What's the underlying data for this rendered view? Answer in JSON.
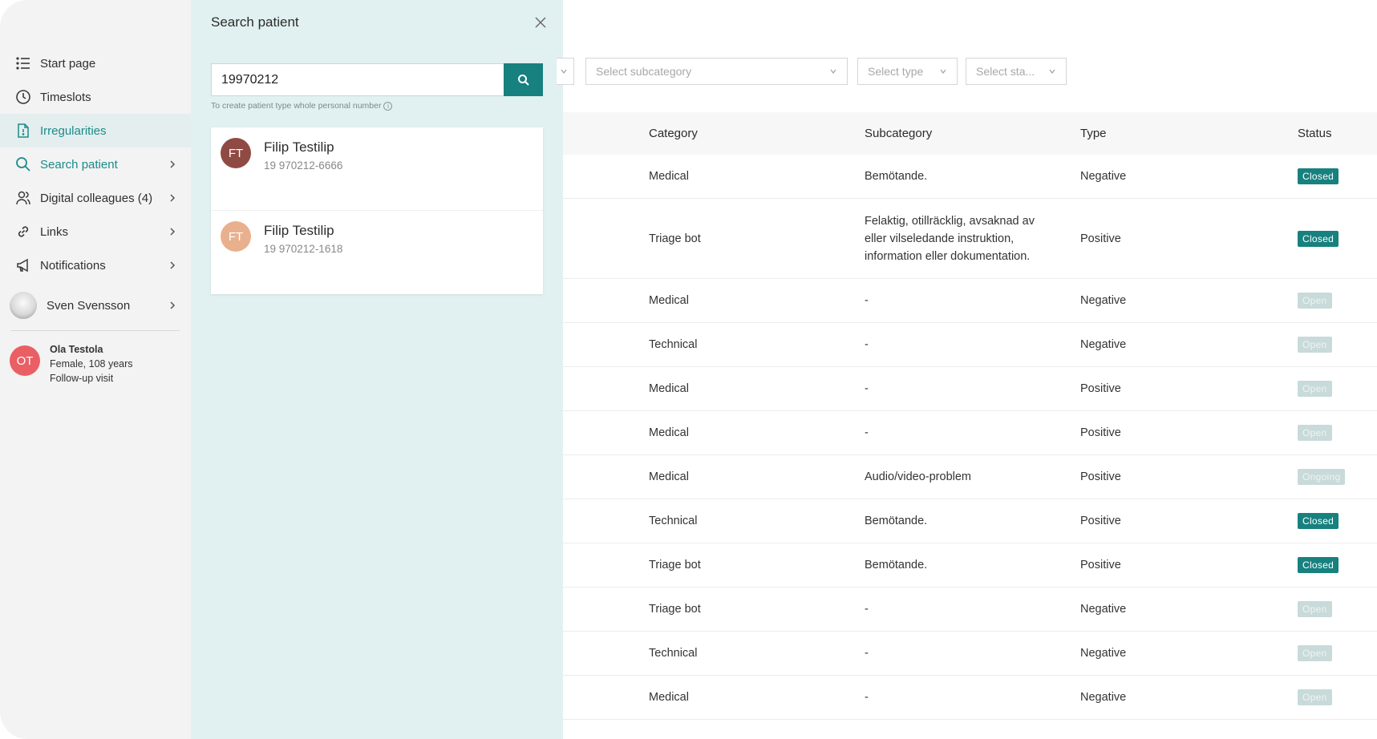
{
  "sidebar": {
    "items": [
      {
        "label": "Start page",
        "icon": "list-icon"
      },
      {
        "label": "Timeslots",
        "icon": "clock-icon"
      },
      {
        "label": "Irregularities",
        "icon": "document-icon"
      },
      {
        "label": "Search patient",
        "icon": "search-icon"
      },
      {
        "label": "Digital colleagues (4)",
        "icon": "people-icon"
      },
      {
        "label": "Links",
        "icon": "link-icon"
      },
      {
        "label": "Notifications",
        "icon": "megaphone-icon"
      }
    ],
    "user": {
      "name": "Sven Svensson"
    },
    "current_patient": {
      "initials": "OT",
      "name": "Ola Testola",
      "details": "Female, 108 years",
      "visit": "Follow-up visit"
    }
  },
  "search_panel": {
    "title": "Search patient",
    "query": "19970212",
    "hint": "To create patient type whole personal number",
    "results": [
      {
        "initials": "FT",
        "name": "Filip Testilip",
        "pnr": "19 970212-6666",
        "color": "#8f4a43"
      },
      {
        "initials": "FT",
        "name": "Filip Testilip",
        "pnr": "19 970212-1618",
        "color": "#e9b08e"
      }
    ]
  },
  "filters": {
    "subcategory": "Select subcategory",
    "type": "Select type",
    "status": "Select sta..."
  },
  "table": {
    "headers": {
      "category": "Category",
      "subcategory": "Subcategory",
      "type": "Type",
      "status": "Status"
    },
    "rows": [
      {
        "category": "Medical",
        "subcategory": "Bemötande.",
        "type": "Negative",
        "status": "Closed"
      },
      {
        "category": "Triage bot",
        "subcategory": "Felaktig, otillräcklig, avsaknad av eller vilseledande instruktion, information eller dokumentation.",
        "type": "Positive",
        "status": "Closed"
      },
      {
        "category": "Medical",
        "subcategory": "-",
        "type": "Negative",
        "status": "Open"
      },
      {
        "category": "Technical",
        "subcategory": "-",
        "type": "Negative",
        "status": "Open"
      },
      {
        "category": "Medical",
        "subcategory": "-",
        "type": "Positive",
        "status": "Open"
      },
      {
        "category": "Medical",
        "subcategory": "-",
        "type": "Positive",
        "status": "Open"
      },
      {
        "category": "Medical",
        "subcategory": "Audio/video-problem",
        "type": "Positive",
        "status": "Ongoing"
      },
      {
        "category": "Technical",
        "subcategory": "Bemötande.",
        "type": "Positive",
        "status": "Closed"
      },
      {
        "category": "Triage bot",
        "subcategory": "Bemötande.",
        "type": "Positive",
        "status": "Closed"
      },
      {
        "category": "Triage bot",
        "subcategory": "-",
        "type": "Negative",
        "status": "Open"
      },
      {
        "category": "Technical",
        "subcategory": "-",
        "type": "Negative",
        "status": "Open"
      },
      {
        "category": "Medical",
        "subcategory": "-",
        "type": "Negative",
        "status": "Open"
      }
    ]
  },
  "colors": {
    "accent": "#17817f",
    "panel_bg": "#e1f0f0",
    "sidebar_bg": "#f3f3f3"
  }
}
